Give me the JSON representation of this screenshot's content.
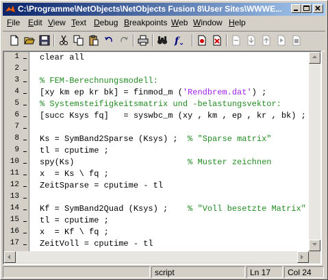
{
  "window": {
    "title": "C:\\Programme\\NetObjects\\NetObjects Fusion 8\\User Sites\\WWWE..."
  },
  "menu": [
    {
      "label": "File"
    },
    {
      "label": "Edit"
    },
    {
      "label": "View"
    },
    {
      "label": "Text"
    },
    {
      "label": "Debug"
    },
    {
      "label": "Breakpoints"
    },
    {
      "label": "Web"
    },
    {
      "label": "Window"
    },
    {
      "label": "Help"
    }
  ],
  "toolbar": {
    "icons": [
      "new-file-icon",
      "open-folder-icon",
      "save-icon",
      "cut-icon",
      "copy-icon",
      "paste-icon",
      "undo-icon",
      "redo-icon",
      "print-icon",
      "find-icon",
      "function-icon",
      "set-breakpoint-icon",
      "clear-breakpoint-icon",
      "step-icon",
      "step-in-icon",
      "step-out-icon",
      "continue-icon",
      "exit-debug-icon"
    ]
  },
  "editor": {
    "lines": [
      {
        "num": "1",
        "text": "clear all"
      },
      {
        "num": "2",
        "text": ""
      },
      {
        "num": "3",
        "text": "% FEM-Berechnungsmodell:"
      },
      {
        "num": "4",
        "text": "[xy km ep kr bk] = finmod_m ('Rendbrem.dat') ;"
      },
      {
        "num": "5",
        "text": "% Systemsteifigkeitsmatrix und -belastungsvektor:"
      },
      {
        "num": "6",
        "text": "[succ Ksys fq]   = syswbc_m (xy , km , ep , kr , bk) ;"
      },
      {
        "num": "7",
        "text": ""
      },
      {
        "num": "8",
        "text": "Ks = SymBand2Sparse (Ksys) ;  % \"Sparse matrix\""
      },
      {
        "num": "9",
        "text": "tl = cputime ;"
      },
      {
        "num": "10",
        "text": "spy(Ks)                       % Muster zeichnen"
      },
      {
        "num": "11",
        "text": "x  = Ks \\ fq ;"
      },
      {
        "num": "12",
        "text": "ZeitSparse = cputime - tl"
      },
      {
        "num": "13",
        "text": ""
      },
      {
        "num": "14",
        "text": "Kf = SymBand2Quad (Ksys) ;    % \"Voll besetzte Matrix\""
      },
      {
        "num": "15",
        "text": "tl = cputime ;"
      },
      {
        "num": "16",
        "text": "x  = Kf \\ fq ;"
      },
      {
        "num": "17",
        "text": "ZeitVoll = cputime - tl"
      }
    ]
  },
  "status": {
    "mode": "script",
    "line": "Ln 17",
    "col": "Col 24"
  }
}
